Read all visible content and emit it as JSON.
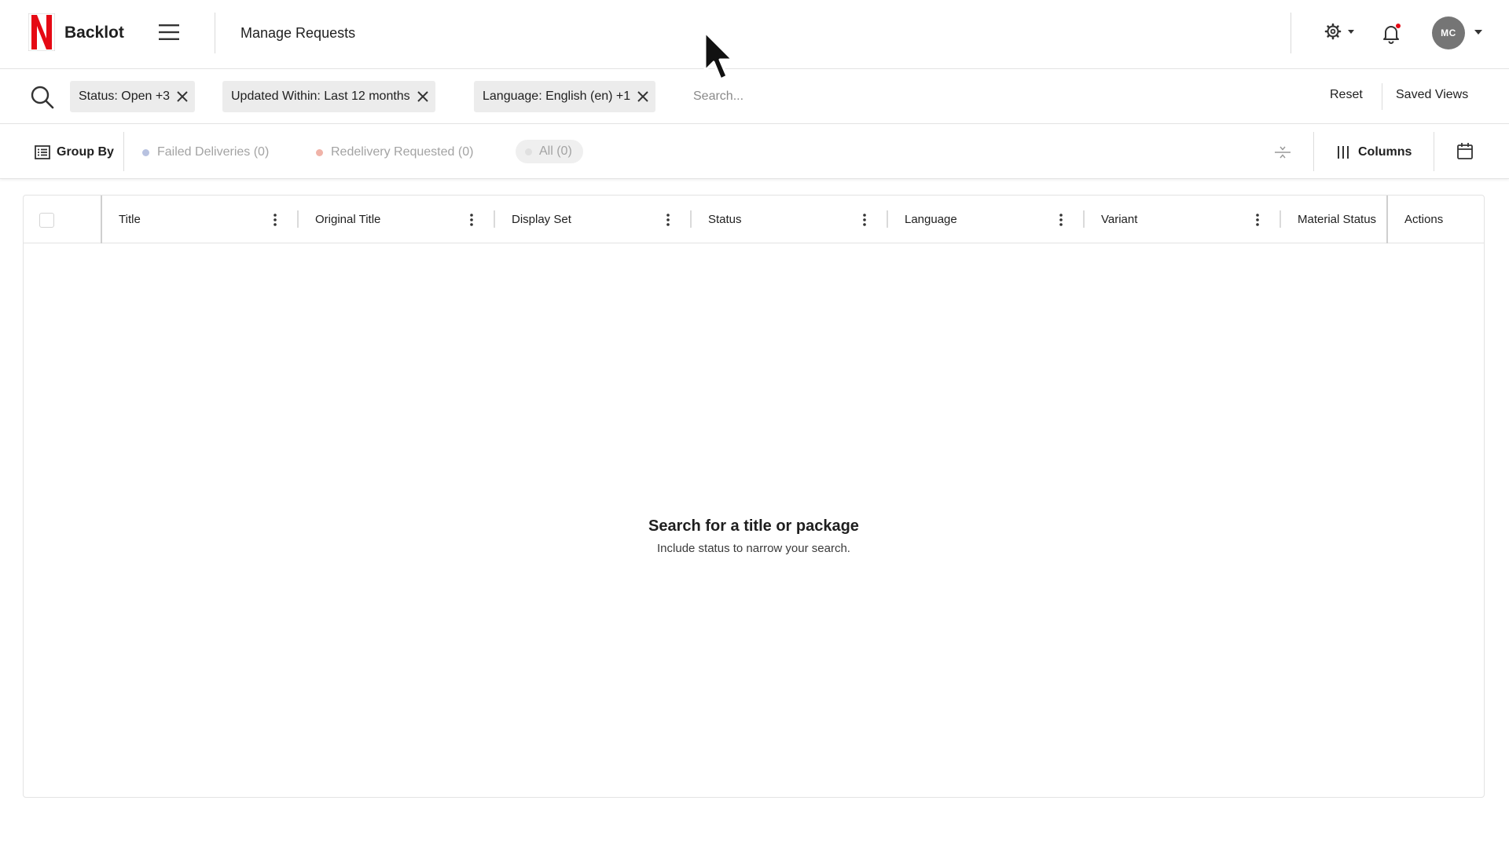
{
  "header": {
    "app_name": "Backlot",
    "page_title": "Manage Requests",
    "avatar_initials": "MC",
    "brand_color": "#e50914",
    "notification_dot_color": "#e50914"
  },
  "filters": {
    "chips": [
      {
        "label": "Status: Open +3"
      },
      {
        "label": "Updated Within: Last 12 months"
      },
      {
        "label": "Language: English (en) +1"
      }
    ],
    "search_placeholder": "Search...",
    "reset_label": "Reset",
    "saved_views_label": "Saved Views"
  },
  "toolbar": {
    "group_by_label": "Group By",
    "status_filters": [
      {
        "label": "Failed Deliveries (0)",
        "dot_color": "#b8c2e0"
      },
      {
        "label": "Redelivery Requested (0)",
        "dot_color": "#f0b3a8"
      }
    ],
    "all_label": "All (0)",
    "columns_label": "Columns"
  },
  "table": {
    "columns": [
      {
        "label": "Title"
      },
      {
        "label": "Original Title"
      },
      {
        "label": "Display Set"
      },
      {
        "label": "Status"
      },
      {
        "label": "Language"
      },
      {
        "label": "Variant"
      },
      {
        "label": "Material Status"
      },
      {
        "label": "Actions"
      }
    ],
    "empty_title": "Search for a title or package",
    "empty_subtitle": "Include status to narrow your search."
  },
  "icons": {
    "logo": "netflix-n-logo",
    "menu": "hamburger-menu-icon",
    "settings": "gear-icon",
    "notifications": "bell-icon",
    "search": "search-icon",
    "remove_chip": "close-icon",
    "group_by": "list-icon",
    "density": "density-icon",
    "columns": "columns-icon",
    "calendar": "calendar-icon",
    "column_menu": "kebab-icon"
  }
}
